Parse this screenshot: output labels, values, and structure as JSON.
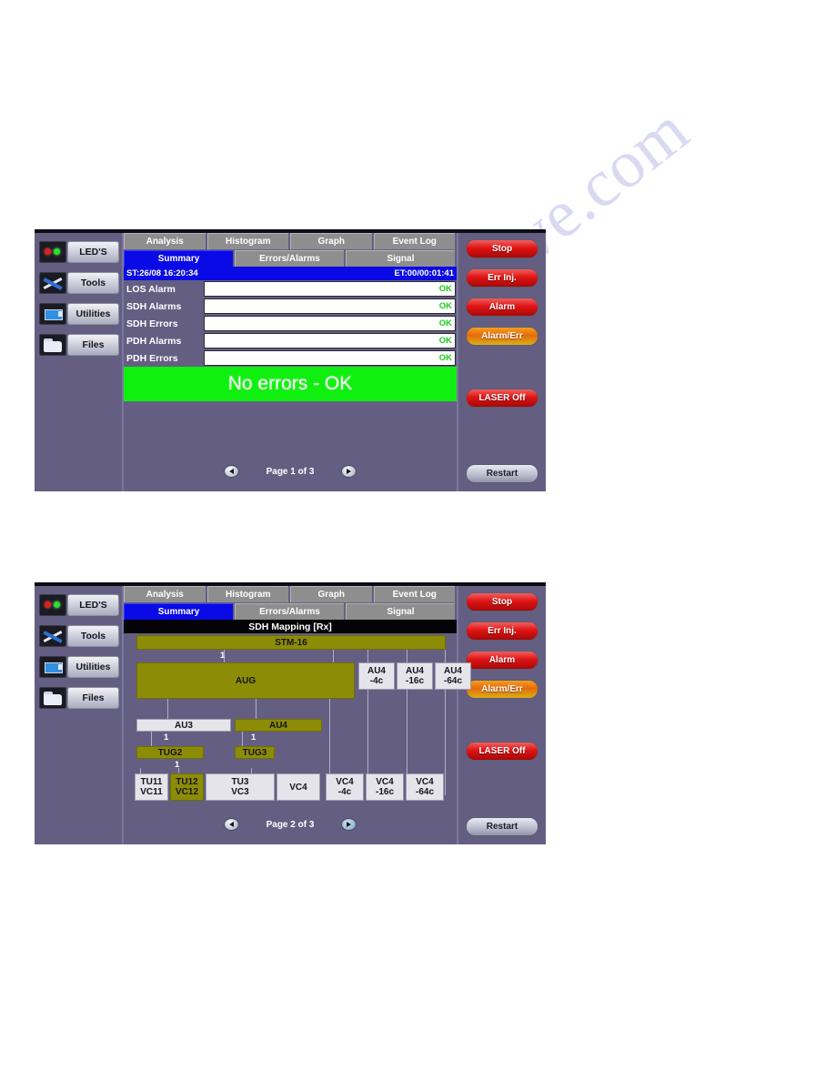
{
  "watermark": "manualshive.com",
  "colors": {
    "panel_bg": "#645f82",
    "tab_inactive": "#8e8e8e",
    "tab_active": "#0a0ae6",
    "status_ok_green": "#10f010",
    "ok_text": "#19cc19",
    "mapping_olive": "#8c8c06",
    "mapping_grey": "#e4e4ea",
    "button_red": "#e01414",
    "button_amber": "#e86a0a"
  },
  "sidebar": {
    "items": [
      {
        "label": "LED'S",
        "icon": "led-indicator-icon"
      },
      {
        "label": "Tools",
        "icon": "tools-icon"
      },
      {
        "label": "Utilities",
        "icon": "utilities-icon"
      },
      {
        "label": "Files",
        "icon": "folder-icon"
      }
    ]
  },
  "tabs_top": [
    {
      "label": "Analysis"
    },
    {
      "label": "Histogram"
    },
    {
      "label": "Graph"
    },
    {
      "label": "Event Log"
    }
  ],
  "tabs_sub": [
    {
      "label": "Summary",
      "active": true
    },
    {
      "label": "Errors/Alarms",
      "active": false
    },
    {
      "label": "Signal",
      "active": false
    }
  ],
  "panel1": {
    "status_bar": {
      "start_time": "ST:26/08 16:20:34",
      "elapsed_time": "ET:00/00:01:41"
    },
    "rows": [
      {
        "label": "LOS Alarm",
        "value": "",
        "status": "OK"
      },
      {
        "label": "SDH Alarms",
        "value": "",
        "status": "OK"
      },
      {
        "label": "SDH Errors",
        "value": "",
        "status": "OK"
      },
      {
        "label": "PDH Alarms",
        "value": "",
        "status": "OK"
      },
      {
        "label": "PDH Errors",
        "value": "",
        "status": "OK"
      }
    ],
    "big_status": "No errors - OK",
    "page_label": "Page 1 of 3",
    "prev_arrow": "◀",
    "next_arrow": "▶"
  },
  "panel2": {
    "title": "SDH Mapping [Rx]",
    "mapping": {
      "stm": {
        "label": "STM-16",
        "highlighted": true
      },
      "aug": {
        "label": "AUG",
        "highlighted": true
      },
      "au4_group": [
        {
          "line1": "AU4",
          "line2": "-4c"
        },
        {
          "line1": "AU4",
          "line2": "-16c"
        },
        {
          "line1": "AU4",
          "line2": "-64c"
        }
      ],
      "au3": {
        "label": "AU3",
        "highlighted": false
      },
      "au4": {
        "label": "AU4",
        "highlighted": true
      },
      "tug2": {
        "label": "TUG2",
        "highlighted": true
      },
      "tug3": {
        "label": "TUG3",
        "highlighted": true
      },
      "bottom": [
        {
          "line1": "TU11",
          "line2": "VC11",
          "highlighted": false
        },
        {
          "line1": "TU12",
          "line2": "VC12",
          "highlighted": true
        },
        {
          "line1": "TU3",
          "line2": "VC3",
          "highlighted": false
        },
        {
          "line1": "VC4",
          "line2": "",
          "highlighted": false
        },
        {
          "line1": "VC4",
          "line2": "-4c",
          "highlighted": false
        },
        {
          "line1": "VC4",
          "line2": "-16c",
          "highlighted": false
        },
        {
          "line1": "VC4",
          "line2": "-64c",
          "highlighted": false
        }
      ],
      "multipliers": {
        "stm_to_aug": "1",
        "au3_branch": "1",
        "au4_branch": "1",
        "tug2_branch": "1"
      }
    },
    "page_label": "Page 2 of 3",
    "prev_arrow": "◀",
    "next_arrow": "▶"
  },
  "right_buttons": [
    {
      "label": "Stop",
      "style": "red"
    },
    {
      "label": "Err Inj.",
      "style": "red"
    },
    {
      "label": "Alarm",
      "style": "red"
    },
    {
      "label": "Alarm/Err",
      "style": "amber"
    },
    {
      "label": "LASER Off",
      "style": "red"
    },
    {
      "label": "Restart",
      "style": "grey"
    }
  ]
}
